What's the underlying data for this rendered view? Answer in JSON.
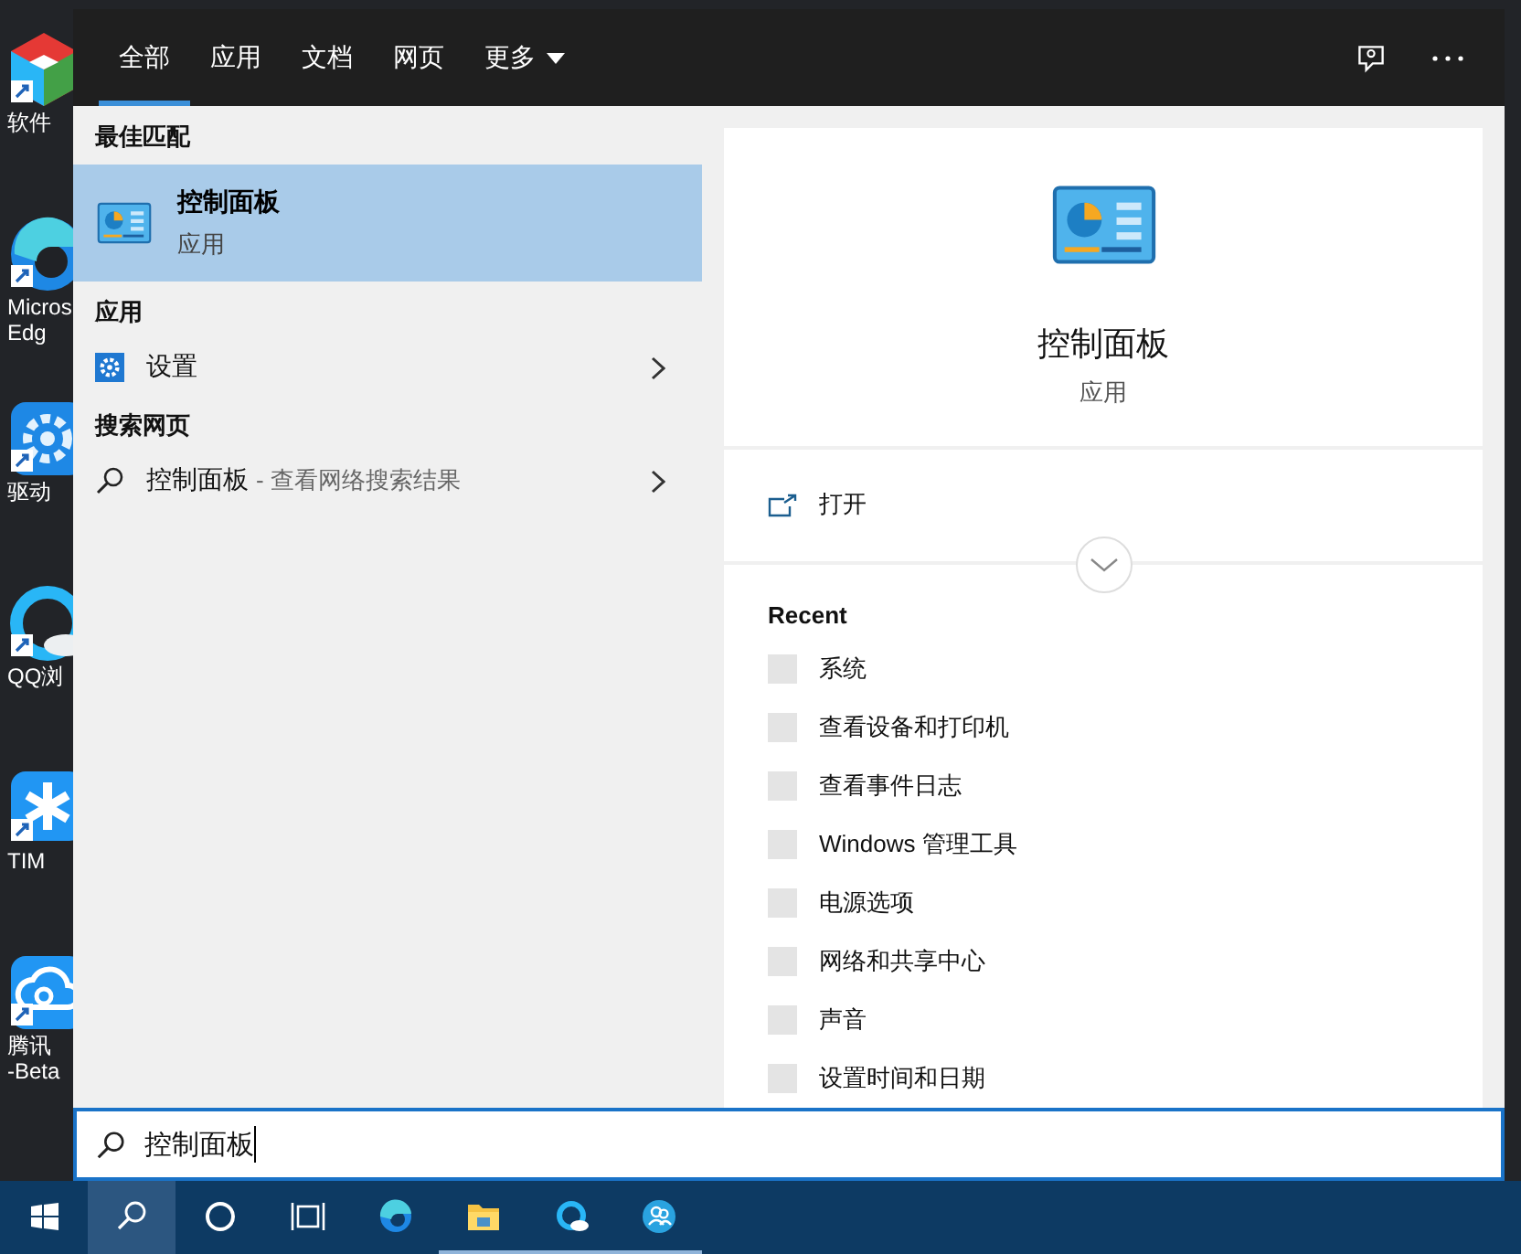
{
  "desktop_icons": [
    {
      "kind": "cube",
      "lines": [
        "软件"
      ]
    },
    {
      "kind": "edge",
      "lines": [
        "Micros",
        "Edg"
      ]
    },
    {
      "kind": "gear",
      "lines": [
        "驱动"
      ]
    },
    {
      "kind": "browser",
      "lines": [
        "QQ浏"
      ]
    },
    {
      "kind": "star",
      "lines": [
        "TIM"
      ]
    },
    {
      "kind": "cloud",
      "lines": [
        "腾讯",
        "-Beta"
      ]
    }
  ],
  "tabs": [
    {
      "label": "全部",
      "selected": true,
      "has_menu": false
    },
    {
      "label": "应用",
      "selected": false,
      "has_menu": false
    },
    {
      "label": "文档",
      "selected": false,
      "has_menu": false
    },
    {
      "label": "网页",
      "selected": false,
      "has_menu": false
    },
    {
      "label": "更多",
      "selected": false,
      "has_menu": true
    }
  ],
  "best_match": {
    "heading": "最佳匹配",
    "title": "控制面板",
    "subtitle": "应用",
    "selected": true
  },
  "sections": [
    {
      "heading": "应用",
      "items": [
        {
          "kind": "app",
          "title": "设置"
        }
      ]
    },
    {
      "heading": "搜索网页",
      "items": [
        {
          "kind": "web",
          "title": "控制面板",
          "hint": "- 查看网络搜索结果"
        }
      ]
    }
  ],
  "preview": {
    "title": "控制面板",
    "subtitle": "应用",
    "actions": [
      {
        "label": "打开"
      }
    ],
    "recent_heading": "Recent",
    "recent": [
      "系统",
      "查看设备和打印机",
      "查看事件日志",
      "Windows 管理工具",
      "电源选项",
      "网络和共享中心",
      "声音",
      "设置时间和日期"
    ]
  },
  "search": {
    "value": "控制面板"
  },
  "taskbar": [
    {
      "kind": "start",
      "selected": false,
      "running": false
    },
    {
      "kind": "search",
      "selected": true,
      "running": false
    },
    {
      "kind": "cortana",
      "selected": false,
      "running": false
    },
    {
      "kind": "taskview",
      "selected": false,
      "running": false
    },
    {
      "kind": "edge",
      "selected": false,
      "running": false
    },
    {
      "kind": "folder",
      "selected": false,
      "running": true
    },
    {
      "kind": "browser",
      "selected": false,
      "running": true
    },
    {
      "kind": "people",
      "selected": false,
      "running": true
    }
  ]
}
